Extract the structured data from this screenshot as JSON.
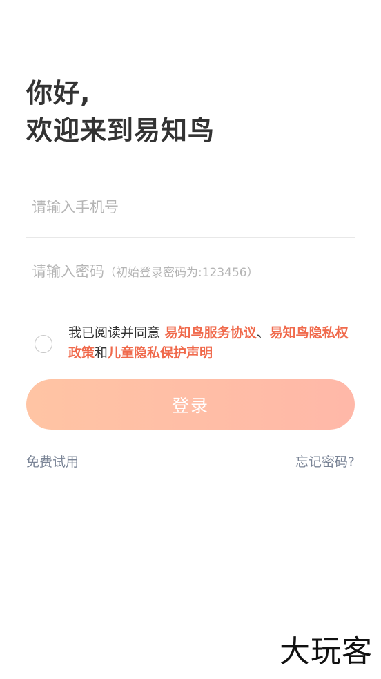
{
  "greeting": {
    "line1": "你好,",
    "line2": "欢迎来到易知鸟"
  },
  "phone_field": {
    "placeholder": "请输入手机号",
    "value": ""
  },
  "password_field": {
    "placeholder_main": "请输入密码",
    "placeholder_hint": "（初始登录密码为:123456）",
    "value": ""
  },
  "agreement": {
    "checked": false,
    "prefix": "我已阅读并同意",
    "service_link": " 易知鸟服务协议",
    "separator": "、",
    "privacy_link": "易知鸟隐私权政策",
    "conjunction": "和",
    "children_link": "儿童隐私保护声明"
  },
  "login_button": {
    "label": "登录"
  },
  "links": {
    "free_trial": "免费试用",
    "forgot_password": "忘记密码?"
  },
  "watermark": "大玩客",
  "colors": {
    "accent_link": "#f06a4c",
    "button_gradient_start": "#ffc4a4",
    "button_gradient_end": "#ffb8a8",
    "secondary_text": "#7a8496"
  }
}
